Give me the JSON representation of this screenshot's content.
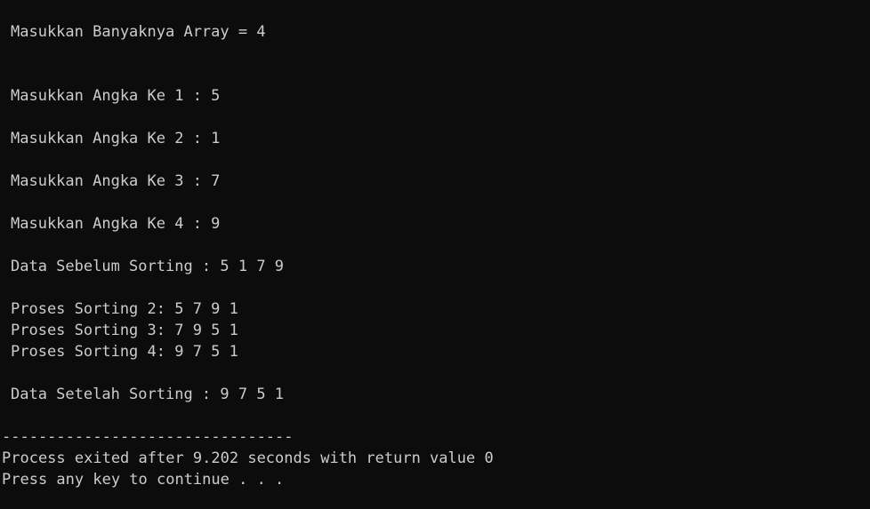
{
  "console": {
    "prompt_count": "Masukkan Banyaknya Array = 4",
    "inputs": [
      "Masukkan Angka Ke 1 : 5",
      "Masukkan Angka Ke 2 : 1",
      "Masukkan Angka Ke 3 : 7",
      "Masukkan Angka Ke 4 : 9"
    ],
    "before_sort": "Data Sebelum Sorting : 5 1 7 9",
    "process": [
      "Proses Sorting 2: 5 7 9 1",
      "Proses Sorting 3: 7 9 5 1",
      "Proses Sorting 4: 9 7 5 1"
    ],
    "after_sort": "Data Setelah Sorting : 9 7 5 1",
    "separator": "--------------------------------",
    "exit_message": "Process exited after 9.202 seconds with return value 0",
    "continue_message": "Press any key to continue . . ."
  }
}
